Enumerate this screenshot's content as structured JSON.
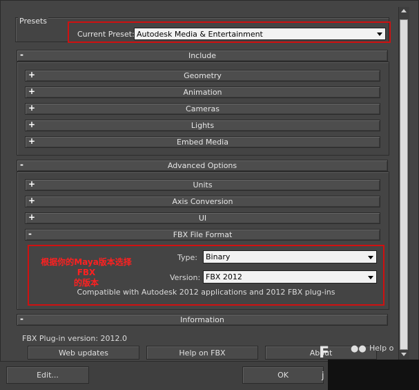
{
  "presets": {
    "group_title": "Presets",
    "current_preset_label": "Current Preset:",
    "current_preset_value": "Autodesk Media & Entertainment"
  },
  "include": {
    "title": "Include",
    "items": [
      "Geometry",
      "Animation",
      "Cameras",
      "Lights",
      "Embed Media"
    ]
  },
  "advanced": {
    "title": "Advanced Options",
    "items": [
      "Units",
      "Axis Conversion",
      "UI"
    ],
    "fbx_format": {
      "title": "FBX File Format",
      "type_label": "Type:",
      "type_value": "Binary",
      "version_label": "Version:",
      "version_value": "FBX 2012",
      "compat_text": "Compatible with Autodesk 2012 applications and 2012 FBX plug-ins",
      "annotation_line1": "根据你的Maya版本选择FBX",
      "annotation_line2": "的版本"
    }
  },
  "information": {
    "title": "Information",
    "version_text": "FBX Plug-in version: 2012.0",
    "web_updates": "Web updates",
    "help_on_fbx": "Help on FBX",
    "about": "About",
    "help_partial": "Help o"
  },
  "footer": {
    "edit": "Edit...",
    "ok": "OK"
  },
  "signs": {
    "expand": "+",
    "collapse": "-"
  },
  "colors": {
    "annotation": "#d01010",
    "background": "#444444"
  }
}
